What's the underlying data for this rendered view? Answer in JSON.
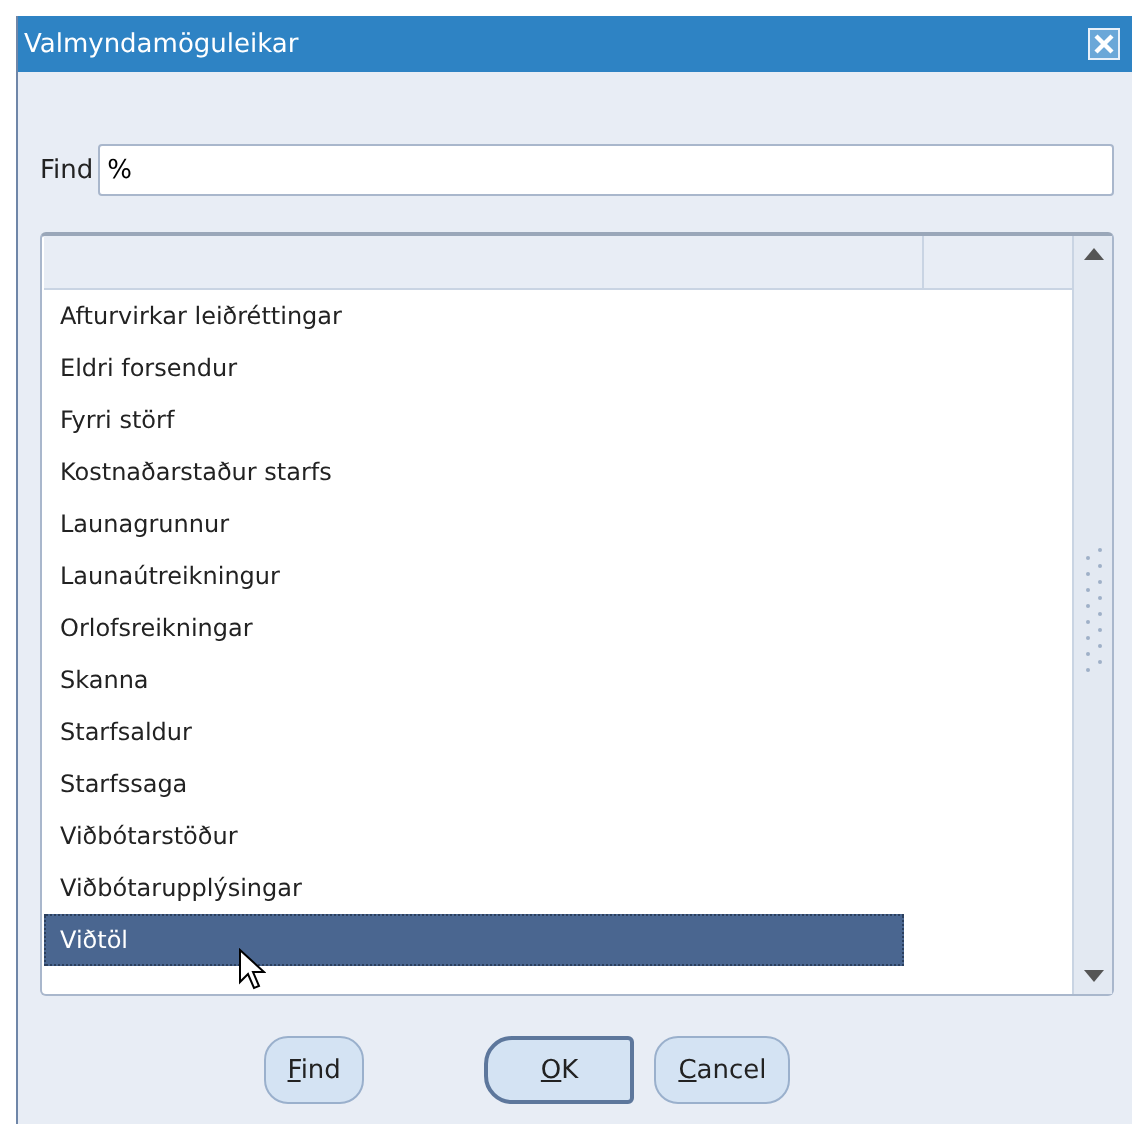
{
  "window": {
    "title": "Valmyndamöguleikar"
  },
  "find": {
    "label": "Find",
    "value": "%"
  },
  "list": {
    "items": [
      {
        "label": "Afturvirkar leiðréttingar",
        "selected": false
      },
      {
        "label": "Eldri forsendur",
        "selected": false
      },
      {
        "label": "Fyrri störf",
        "selected": false
      },
      {
        "label": "Kostnaðarstaður starfs",
        "selected": false
      },
      {
        "label": "Launagrunnur",
        "selected": false
      },
      {
        "label": "Launaútreikningur",
        "selected": false
      },
      {
        "label": "Orlofsreikningar",
        "selected": false
      },
      {
        "label": "Skanna",
        "selected": false
      },
      {
        "label": "Starfsaldur",
        "selected": false
      },
      {
        "label": "Starfssaga",
        "selected": false
      },
      {
        "label": "Viðbótarstöður",
        "selected": false
      },
      {
        "label": "Viðbótarupplýsingar",
        "selected": false
      },
      {
        "label": "Viðtöl",
        "selected": true
      }
    ]
  },
  "buttons": [
    {
      "label": "Find",
      "default": false
    },
    {
      "label": "OK",
      "default": true
    },
    {
      "label": "Cancel",
      "default": false
    }
  ]
}
